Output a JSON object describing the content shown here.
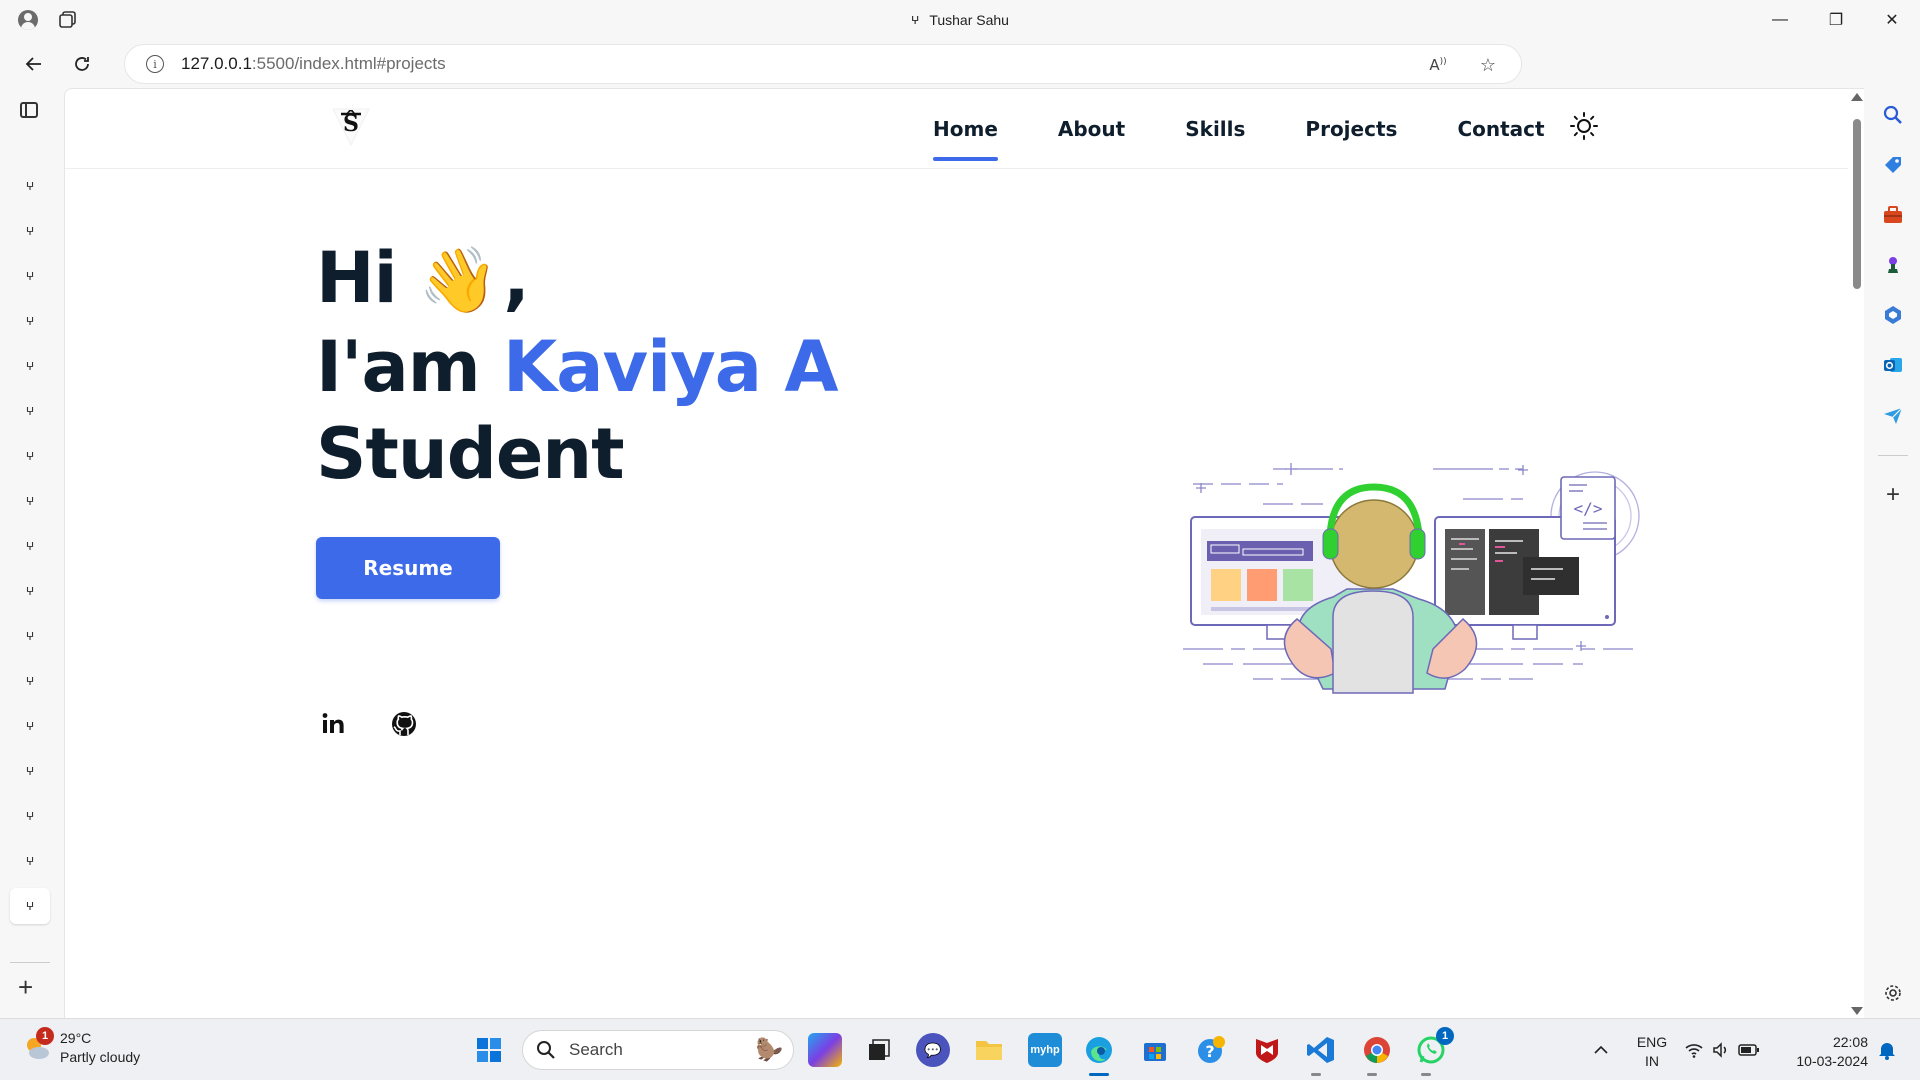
{
  "browser": {
    "window_title": "Tushar Sahu",
    "url_host": "127.0.0.1",
    "url_rest": ":5500/index.html#projects",
    "tab_favicon": "ⵖ",
    "tab_count": 17
  },
  "site": {
    "nav": {
      "home": "Home",
      "about": "About",
      "skills": "Skills",
      "projects": "Projects",
      "contact": "Contact"
    },
    "hero": {
      "greeting": "Hi",
      "wave_emoji": "👋",
      "comma": ",",
      "iam": "I'am",
      "name": "Kaviya A",
      "role": "Student",
      "resume_label": "Resume"
    },
    "colors": {
      "accent": "#3d6ae8",
      "text": "#0f1e2d"
    }
  },
  "taskbar": {
    "weather_temp": "29°C",
    "weather_desc": "Partly cloudy",
    "weather_badge": "1",
    "search_placeholder": "Search",
    "lang_top": "ENG",
    "lang_bottom": "IN",
    "time": "22:08",
    "date": "10-03-2024",
    "whatsapp_badge": "1"
  }
}
